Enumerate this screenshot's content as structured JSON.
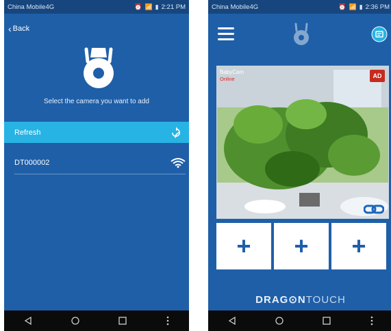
{
  "left_phone": {
    "status": {
      "carrier": "China Mobile4G",
      "time": "2:21 PM"
    },
    "back_label": "Back",
    "instruction": "Select the camera you want to add",
    "refresh_label": "Refresh",
    "devices": [
      {
        "name": "DT000002",
        "icon": "wifi-icon"
      }
    ],
    "icons": {
      "logo": "camera-logo-icon",
      "refresh": "refresh-icon"
    }
  },
  "right_phone": {
    "status": {
      "carrier": "China Mobile4G",
      "time": "2:36 PM"
    },
    "camera_view": {
      "title": "BabyCam",
      "status": "Online",
      "badge": "AD",
      "icons": {
        "connection": "link-icon"
      }
    },
    "add_slots": [
      {
        "label": "+"
      },
      {
        "label": "+"
      },
      {
        "label": "+"
      }
    ],
    "brand": {
      "part1": "DRAG",
      "part2": "N",
      "part3": "TOUCH"
    },
    "icons": {
      "menu": "hamburger-menu-icon",
      "top_right": "message-icon",
      "logo": "camera-logo-icon"
    }
  },
  "colors": {
    "primary": "#1f5fa8",
    "accent": "#27b3e4",
    "status_red": "#e62020"
  }
}
